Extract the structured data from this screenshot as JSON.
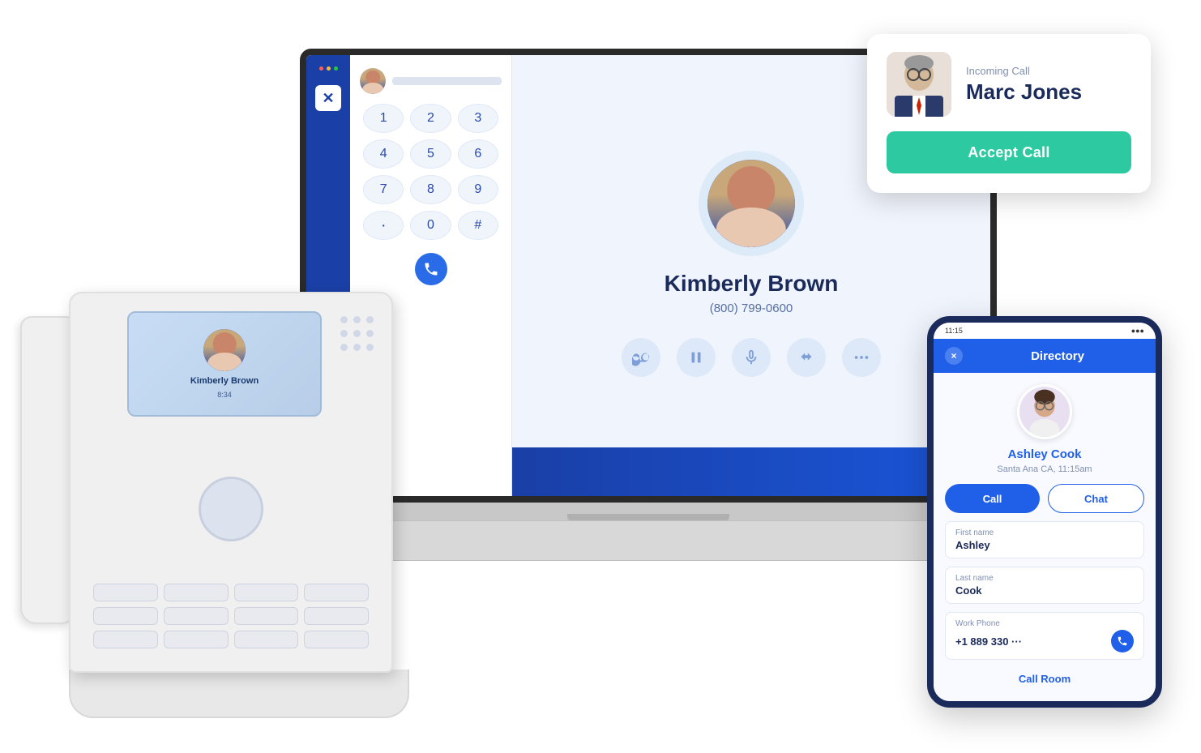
{
  "scene": {
    "background": "#ffffff"
  },
  "incoming_card": {
    "label": "Incoming Call",
    "caller_name": "Marc Jones",
    "accept_btn_label": "Accept Call"
  },
  "desktop_app": {
    "dialer": {
      "keys": [
        "1",
        "2",
        "3",
        "4",
        "5",
        "6",
        "7",
        "8",
        "9",
        "·",
        "0",
        "#"
      ]
    },
    "call_view": {
      "contact_name": "Kimberly Brown",
      "contact_phone": "(800) 799-0600"
    }
  },
  "desk_phone": {
    "screen_name": "Kimberly Brown",
    "screen_time": "8:34"
  },
  "mobile_directory": {
    "header_title": "Directory",
    "close_label": "×",
    "contact_name": "Ashley Cook",
    "contact_location": "Santa Ana CA, 11:15am",
    "call_btn_label": "Call",
    "chat_btn_label": "Chat",
    "first_name_label": "First name",
    "first_name_value": "Ashley",
    "last_name_label": "Last name",
    "last_name_value": "Cook",
    "work_phone_label": "Work Phone",
    "work_phone_value": "+1 889 330 ···",
    "call_room_label": "Call Room",
    "status_time": "11:15",
    "status_icons": "●●●"
  }
}
